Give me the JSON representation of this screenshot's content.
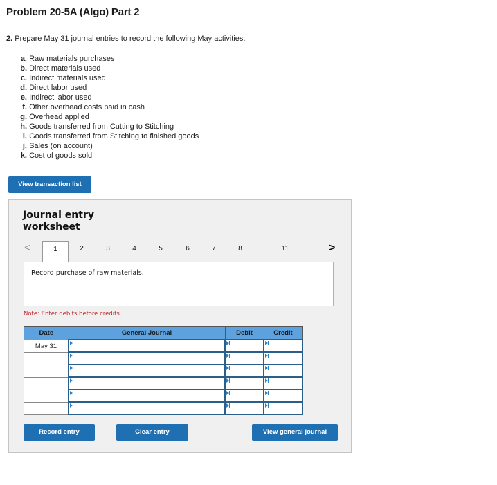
{
  "page": {
    "title": "Problem 20-5A (Algo) Part 2",
    "prompt_number": "2.",
    "prompt_text": " Prepare May 31 journal entries to record the following May activities:"
  },
  "activities": [
    {
      "letter": "a.",
      "text": "Raw materials purchases"
    },
    {
      "letter": "b.",
      "text": "Direct materials used"
    },
    {
      "letter": "c.",
      "text": "Indirect materials used"
    },
    {
      "letter": "d.",
      "text": "Direct labor used"
    },
    {
      "letter": "e.",
      "text": "Indirect labor used"
    },
    {
      "letter": "f.",
      "text": "Other overhead costs paid in cash"
    },
    {
      "letter": "g.",
      "text": "Overhead applied"
    },
    {
      "letter": "h.",
      "text": "Goods transferred from Cutting to Stitching"
    },
    {
      "letter": "i.",
      "text": "Goods transferred from Stitching to finished goods"
    },
    {
      "letter": "j.",
      "text": "Sales (on account)"
    },
    {
      "letter": "k.",
      "text": "Cost of goods sold"
    }
  ],
  "buttons": {
    "view_transaction_list": "View transaction list",
    "record_entry": "Record entry",
    "clear_entry": "Clear entry",
    "view_general_journal": "View general journal"
  },
  "worksheet": {
    "title_line1": "Journal entry",
    "title_line2": "worksheet",
    "prev_glyph": "<",
    "next_glyph": ">",
    "tabs": [
      "1",
      "2",
      "3",
      "4",
      "5",
      "6",
      "7",
      "8",
      "11"
    ],
    "active_tab": "1",
    "description": "Record purchase of raw materials.",
    "note": "Note: Enter debits before credits."
  },
  "journal": {
    "headers": {
      "date": "Date",
      "general_journal": "General Journal",
      "debit": "Debit",
      "credit": "Credit"
    },
    "rows": [
      {
        "date": "May 31",
        "account": "",
        "debit": "",
        "credit": ""
      },
      {
        "date": "",
        "account": "",
        "debit": "",
        "credit": ""
      },
      {
        "date": "",
        "account": "",
        "debit": "",
        "credit": ""
      },
      {
        "date": "",
        "account": "",
        "debit": "",
        "credit": ""
      },
      {
        "date": "",
        "account": "",
        "debit": "",
        "credit": ""
      },
      {
        "date": "",
        "account": "",
        "debit": "",
        "credit": ""
      }
    ]
  },
  "colors": {
    "button_blue": "#1f70b3",
    "header_blue": "#5da2de",
    "note_red": "#c0272d",
    "panel_bg": "#f0f0f0"
  }
}
